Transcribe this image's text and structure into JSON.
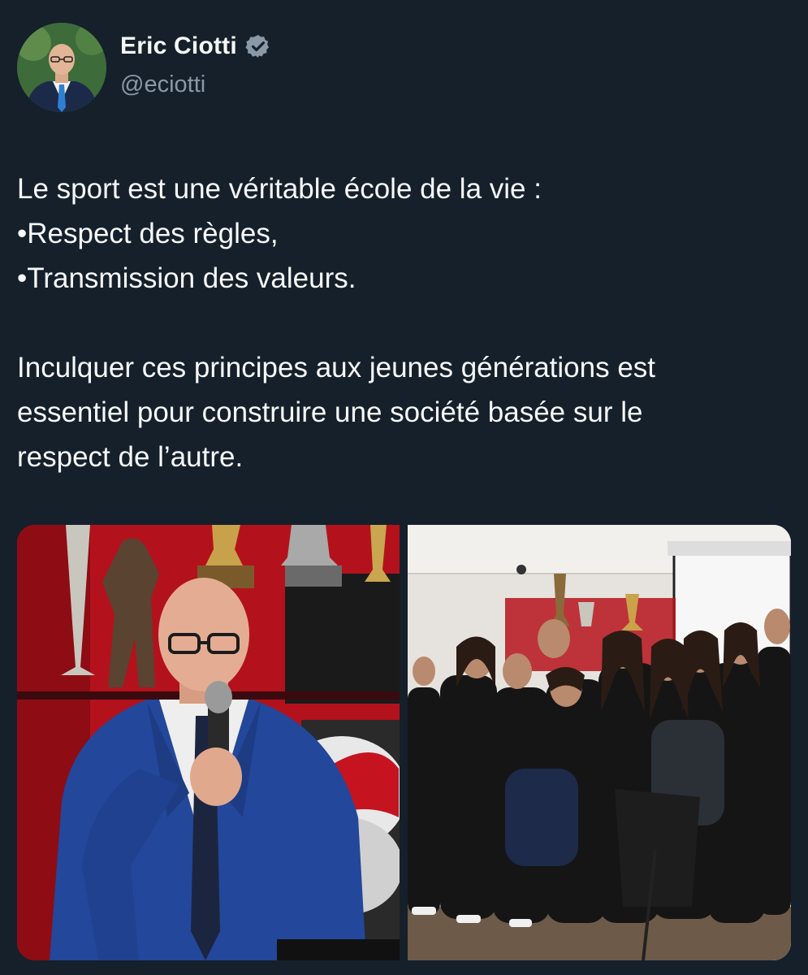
{
  "author": {
    "display_name": "Eric Ciotti",
    "handle": "@eciotti",
    "verified": true,
    "verified_color": "#8b98a5",
    "avatar_icon": "profile-photo"
  },
  "tweet": {
    "lines": [
      "Le sport est une véritable école de la vie :",
      "•Respect des règles,",
      "•Transmission des valeurs.",
      "Inculquer ces principes aux jeunes générations est",
      "essentiel pour construire une société basée sur le",
      "respect de l’autre."
    ]
  },
  "media": {
    "count": 2,
    "photos": [
      {
        "icon": "photo-speaker-with-microphone"
      },
      {
        "icon": "photo-group-of-athletes"
      }
    ]
  },
  "colors": {
    "background": "#15202b",
    "text": "#f7f9f9",
    "secondary_text": "#8b98a5"
  }
}
